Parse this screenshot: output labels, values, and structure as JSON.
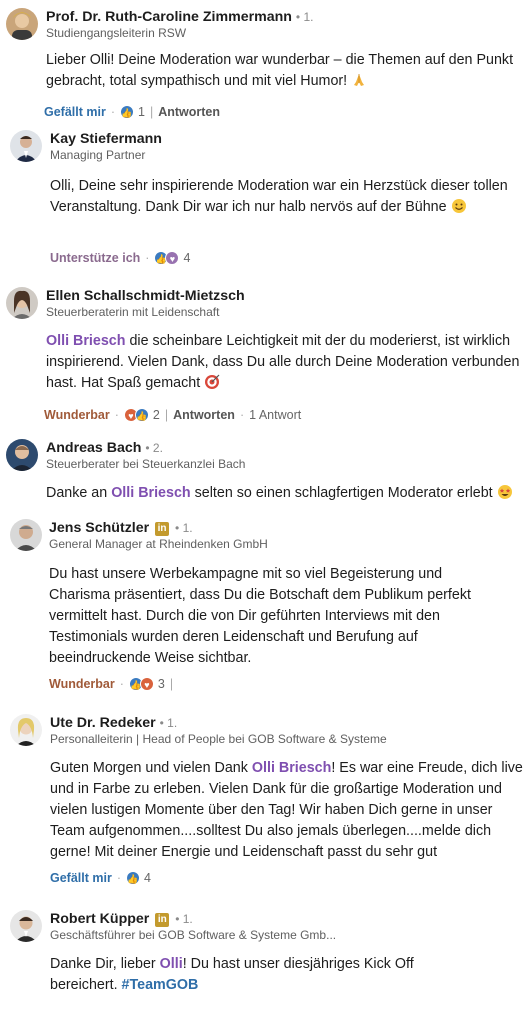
{
  "colors": {
    "mention": "#7f4fb0",
    "hashtag": "#2f6ea8",
    "like": "#2f6ea8",
    "love": "#a05a39"
  },
  "comments": [
    {
      "name": "Prof. Dr. Ruth-Caroline Zimmermann",
      "degree": "• 1.",
      "headline": "Studiengangsleiterin RSW",
      "text": "Lieber Olli! Deine Moderation war wunderbar – die Themen auf den Punkt gebracht, total sympathisch und mit viel Humor!",
      "emoji": "praying-hands",
      "reaction_label": "Gefällt mir",
      "reaction_count": "1",
      "reply_label": "Antworten"
    },
    {
      "name": "Kay Stiefermann",
      "headline": "Managing Partner",
      "text": "Olli, Deine sehr inspirierende Moderation war ein Herzstück dieser tollen Veranstaltung. Dank Dir war ich nur halb nervös auf der Bühne",
      "emoji": "smile",
      "reaction_label": "Unterstütze ich",
      "reaction_count": "4"
    },
    {
      "name": "Ellen Schallschmidt-Mietzsch",
      "headline": "Steuerberaterin mit Leidenschaft",
      "mention": "Olli Briesch",
      "text": " die scheinbare Leichtigkeit mit der du moderierst, ist wirklich inspirierend. Vielen Dank, dass Du alle durch Deine Moderation verbunden hast. Hat Spaß gemacht",
      "emoji": "target",
      "reaction_label": "Wunderbar",
      "reaction_count": "2",
      "reply_label": "Antworten",
      "replies_label": "1 Antwort"
    },
    {
      "name": "Andreas Bach",
      "degree": "• 2.",
      "headline": "Steuerberater bei Steuerkanzlei Bach",
      "text_before": "Danke an ",
      "mention": "Olli Briesch",
      "text": " selten so einen schlagfertigen Moderator erlebt",
      "emoji": "star-struck"
    },
    {
      "name": "Jens Schützler",
      "badge": "in",
      "degree": "• 1.",
      "headline": "General Manager at Rheindenken GmbH",
      "text": "Du hast unsere Werbekampagne mit so viel Begeisterung und Charisma präsentiert, dass Du die Botschaft dem Publikum perfekt vermittelt hast. Durch die von Dir geführten Interviews mit den Testimonials wurden deren Leidenschaft und Berufung auf beeindruckende Weise sichtbar.",
      "reaction_label": "Wunderbar",
      "reaction_count": "3"
    },
    {
      "name": "Ute Dr. Redeker",
      "degree": "• 1.",
      "headline": "Personalleiterin | Head of People bei GOB Software & Systeme",
      "text_before": "Guten Morgen und vielen Dank ",
      "mention": "Olli Briesch",
      "text": "! Es war eine Freude, dich live und in Farbe zu erleben. Vielen Dank für die großartige Moderation und vielen lustigen Momente über den Tag! Wir haben Dich gerne in unser Team aufgenommen....solltest Du also jemals überlegen....melde dich gerne! Mit deiner Energie und Leidenschaft passt du sehr gut",
      "reaction_label": "Gefällt mir",
      "reaction_count": "4"
    },
    {
      "name": "Robert Küpper",
      "badge": "in",
      "degree": "• 1.",
      "headline": "Geschäftsführer bei GOB Software & Systeme Gmb...",
      "text_before": "Danke Dir, lieber ",
      "mention": "Olli",
      "text": "! Du hast unser diesjähriges Kick Off bereichert. ",
      "hashtag": "#TeamGOB"
    }
  ]
}
